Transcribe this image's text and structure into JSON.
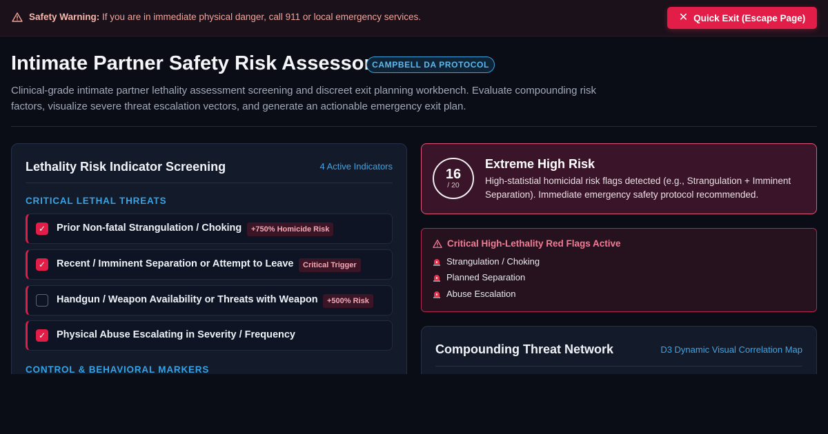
{
  "warning": {
    "label": "Safety Warning:",
    "text": " If you are in immediate physical danger, call 911 or local emergency services.",
    "exit_label": "Quick Exit (Escape Page)"
  },
  "header": {
    "title": "Intimate Partner Safety Risk Assessor",
    "badge": "CAMPBELL DA PROTOCOL",
    "subtitle": "Clinical-grade intimate partner lethality assessment screening and discreet exit planning workbench. Evaluate compounding risk factors, visualize severe threat escalation vectors, and generate an actionable emergency exit plan."
  },
  "screening": {
    "title": "Lethality Risk Indicator Screening",
    "active_count": "4 Active Indicators",
    "section1": "CRITICAL LETHAL THREATS",
    "section2": "CONTROL & BEHAVIORAL MARKERS",
    "items": [
      {
        "label": "Prior Non-fatal Strangulation / Choking",
        "tag": "+750% Homicide Risk",
        "checked": true
      },
      {
        "label": "Recent / Imminent Separation or Attempt to Leave",
        "tag": "Critical Trigger",
        "checked": true
      },
      {
        "label": "Handgun / Weapon Availability or Threats with Weapon",
        "tag": "+500% Risk",
        "checked": false
      },
      {
        "label": "Physical Abuse Escalating in Severity / Frequency",
        "tag": "",
        "checked": true
      }
    ],
    "check_glyph": "✓"
  },
  "score": {
    "value": "16",
    "max": "/ 20",
    "level": "Extreme High Risk",
    "description": "High-statistial homicidal risk flags detected (e.g., Strangulation + Imminent Separation). Immediate emergency safety protocol recommended."
  },
  "red_flags": {
    "title": "Critical High-Lethality Red Flags Active",
    "items": [
      "Strangulation / Choking",
      "Planned Separation",
      "Abuse Escalation"
    ]
  },
  "network": {
    "title": "Compounding Threat Network",
    "subtitle": "D3 Dynamic Visual Correlation Map"
  },
  "colors": {
    "accent": "#e11d48",
    "link": "#3ea6e8",
    "background": "#0a0d16"
  }
}
